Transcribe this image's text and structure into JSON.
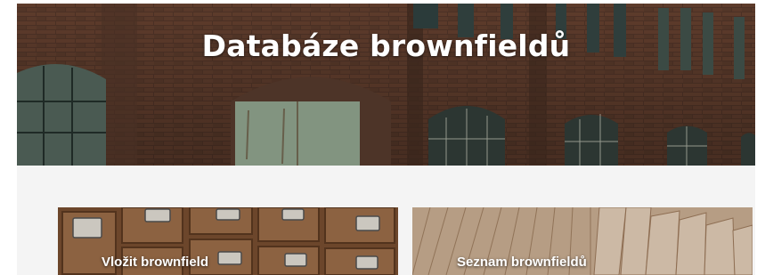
{
  "hero": {
    "title": "Databáze brownfieldů"
  },
  "cards": [
    {
      "label": "Vložit brownfield"
    },
    {
      "label": "Seznam brownfieldů"
    }
  ]
}
